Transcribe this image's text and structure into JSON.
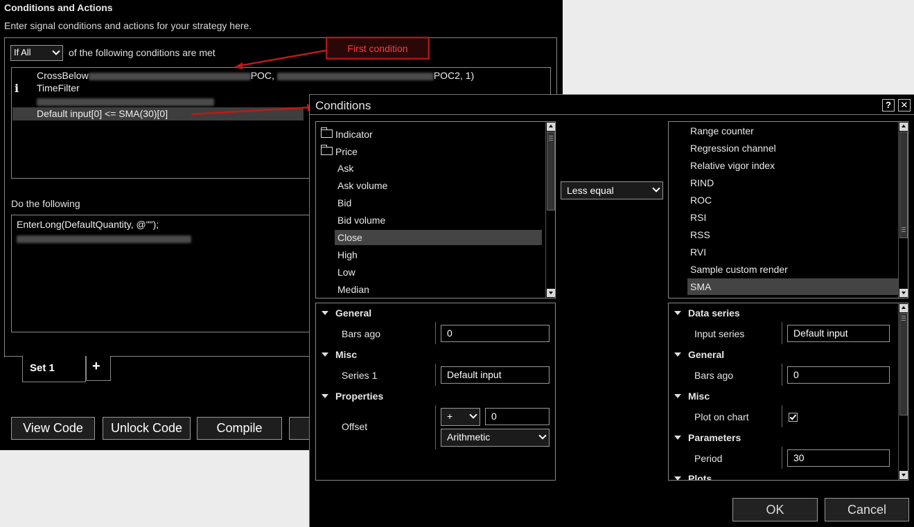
{
  "main": {
    "title": "Conditions and Actions",
    "subtitle": "Enter signal conditions and actions for your strategy here.",
    "if_select": "If All",
    "if_suffix": "of the following conditions are met",
    "conditions": [
      {
        "prefix": "CrossBelow",
        "mid": "POC,",
        "suffix": "POC2, 1)"
      },
      {
        "text": "TimeFilter"
      },
      {
        "text": "Default input[0] <= SMA(30)[0]"
      }
    ],
    "callout": "First condition",
    "do_label": "Do the following",
    "actions": [
      "EnterLong(DefaultQuantity, @\"\");"
    ],
    "tabs": [
      "Set 1",
      "+"
    ],
    "buttons": [
      "View Code",
      "Unlock Code",
      "Compile"
    ],
    "accent": "#b01818"
  },
  "dialog": {
    "title": "Conditions",
    "help": "?",
    "close": "✕",
    "left_tree": {
      "folders": [
        "Indicator",
        "Price"
      ],
      "items": [
        "Ask",
        "Ask volume",
        "Bid",
        "Bid volume",
        "Close",
        "High",
        "Low",
        "Median"
      ],
      "selected": "Close"
    },
    "operator": "Less equal",
    "right_list": {
      "items": [
        "Range counter",
        "Regression channel",
        "Relative vigor index",
        "RIND",
        "ROC",
        "RSI",
        "RSS",
        "RVI",
        "Sample custom render",
        "SMA"
      ],
      "selected": "SMA"
    },
    "left_props": {
      "general": "General",
      "bars_ago_label": "Bars ago",
      "bars_ago": "0",
      "misc": "Misc",
      "series_label": "Series 1",
      "series": "Default input",
      "properties": "Properties",
      "offset_label": "Offset",
      "offset_sign": "+",
      "offset_value": "0",
      "offset_type": "Arithmetic"
    },
    "right_props": {
      "data_series": "Data series",
      "input_series_label": "Input series",
      "input_series": "Default input",
      "general": "General",
      "bars_ago_label": "Bars ago",
      "bars_ago": "0",
      "misc": "Misc",
      "plot_label": "Plot on chart",
      "plot_on_chart": true,
      "parameters": "Parameters",
      "period_label": "Period",
      "period": "30",
      "plots_partial": "Plots"
    },
    "ok": "OK",
    "cancel": "Cancel"
  }
}
